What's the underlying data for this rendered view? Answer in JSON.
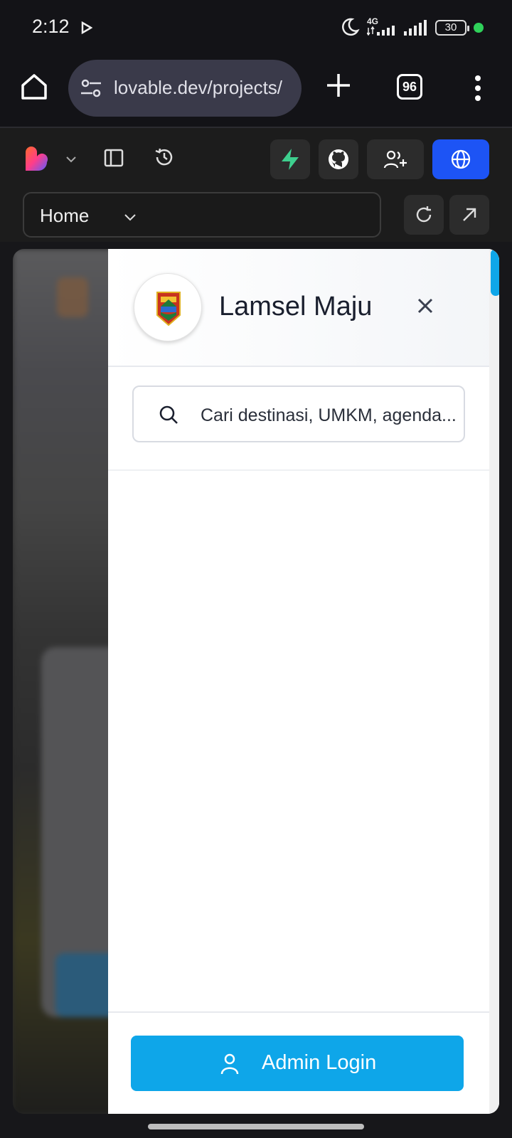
{
  "status_bar": {
    "time": "2:12",
    "network": "4G",
    "battery": "30",
    "icons": [
      "play-icon",
      "moon-icon",
      "signal-icon",
      "battery-icon"
    ]
  },
  "browser": {
    "url": "lovable.dev/projects/",
    "tab_count": "96",
    "icons": [
      "home-icon",
      "tune-icon",
      "plus-icon",
      "more-vert-icon"
    ]
  },
  "lovable_toolbar": {
    "route_label": "Home",
    "icons": [
      "lovable-heart-icon",
      "sidebar-icon",
      "history-icon",
      "supabase-icon",
      "github-icon",
      "invite-user-icon",
      "globe-icon",
      "refresh-icon",
      "external-link-icon"
    ],
    "accent_color": "#1d54f5"
  },
  "drawer": {
    "brand_name": "Lamsel Maju",
    "search_placeholder": "Cari destinasi, UMKM, agenda...",
    "admin_button_label": "Admin Login",
    "primary_color": "#0ea6e9"
  }
}
